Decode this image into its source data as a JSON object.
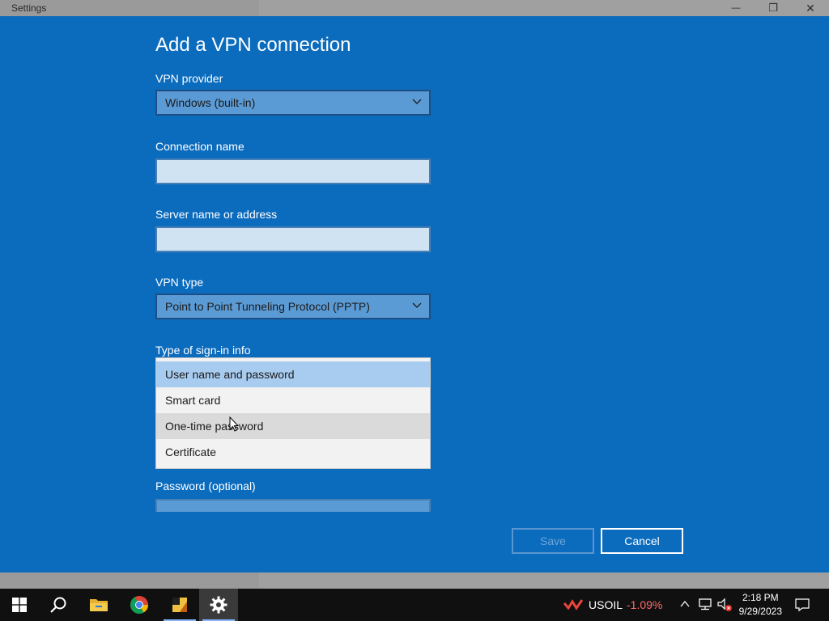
{
  "window": {
    "title": "Settings",
    "minimize_glyph": "—",
    "restore_glyph": "❐",
    "close_glyph": "✕"
  },
  "dialog": {
    "title": "Add a VPN connection",
    "vpn_provider": {
      "label": "VPN provider",
      "value": "Windows (built-in)"
    },
    "connection_name": {
      "label": "Connection name",
      "value": ""
    },
    "server": {
      "label": "Server name or address",
      "value": ""
    },
    "vpn_type": {
      "label": "VPN type",
      "value": "Point to Point Tunneling Protocol (PPTP)"
    },
    "signin": {
      "label": "Type of sign-in info",
      "options": [
        "User name and password",
        "Smart card",
        "One-time password",
        "Certificate"
      ],
      "selected": "User name and password",
      "hovered": "One-time password"
    },
    "password": {
      "label": "Password (optional)"
    },
    "save_label": "Save",
    "cancel_label": "Cancel"
  },
  "taskbar": {
    "icons": [
      "windows-start-icon",
      "search-icon",
      "file-explorer-icon",
      "chrome-icon",
      "app-icon",
      "settings-icon"
    ],
    "stock": {
      "symbol": "USOIL",
      "change": "-1.09%",
      "change_color": "#ff6b6b"
    },
    "time": "2:18 PM",
    "date": "9/29/2023"
  },
  "colors": {
    "dialog_bg": "#0b6bbd",
    "accent": "#5b9bd5"
  }
}
